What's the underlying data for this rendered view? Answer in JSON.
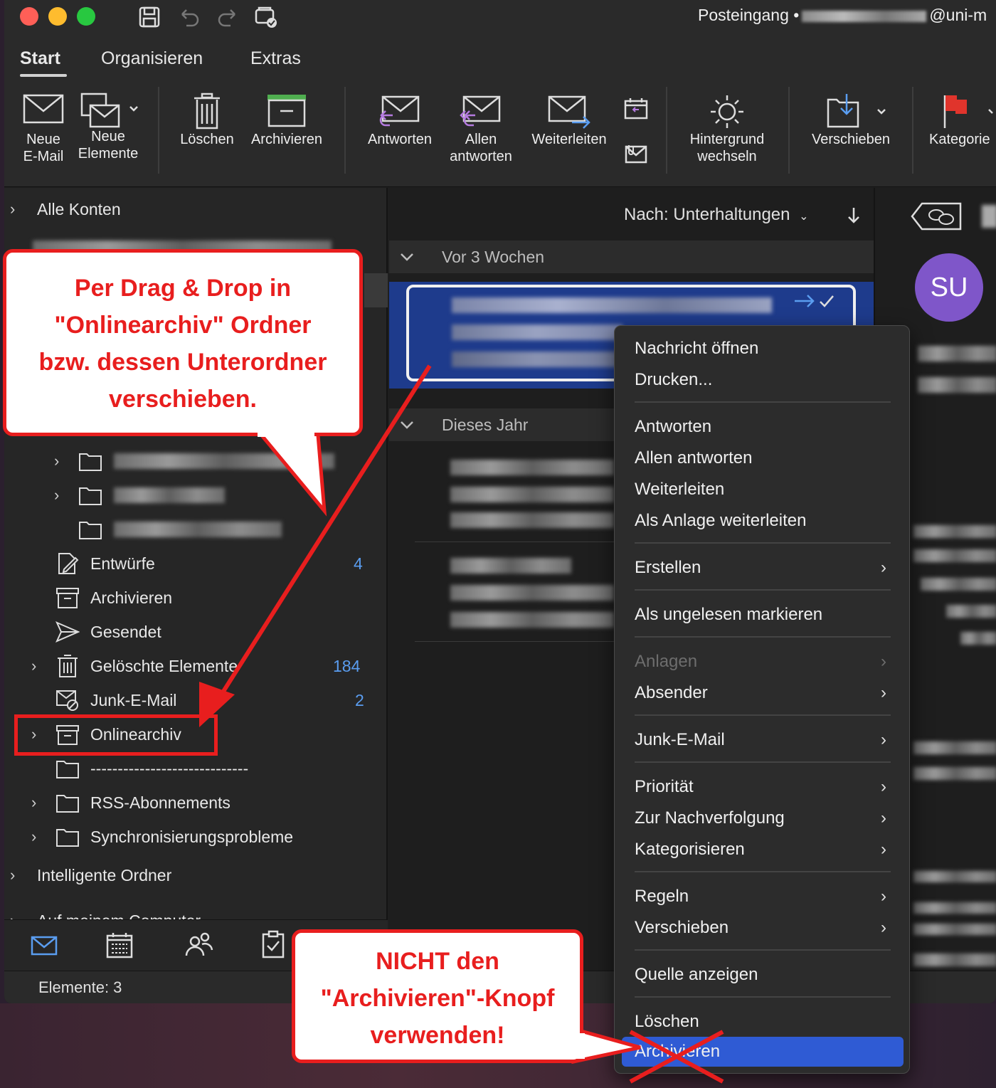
{
  "titlebar": {
    "title_prefix": "Posteingang •",
    "title_suffix": "@uni-m",
    "save_icon": "save-icon",
    "undo_icon": "undo-icon",
    "redo_icon": "redo-icon",
    "sync_icon": "sync-icon"
  },
  "ribbon": {
    "tabs": [
      "Start",
      "Organisieren",
      "Extras"
    ],
    "buttons": {
      "new_email": [
        "Neue",
        "E-Mail"
      ],
      "new_items": [
        "Neue",
        "Elemente"
      ],
      "delete": "Löschen",
      "archive": "Archivieren",
      "reply": "Antworten",
      "reply_all": [
        "Allen",
        "antworten"
      ],
      "forward": "Weiterleiten",
      "background": [
        "Hintergrund",
        "wechseln"
      ],
      "move": "Verschieben",
      "categorize": "Kategorie"
    }
  },
  "sidebar": {
    "all_accounts": "Alle Konten",
    "folders": {
      "drafts": "Entwürfe",
      "drafts_count": "4",
      "archive": "Archivieren",
      "sent": "Gesendet",
      "deleted": "Gelöschte Elemente",
      "deleted_count": "184",
      "junk": "Junk-E-Mail",
      "junk_count": "2",
      "online_archive": "Onlinearchiv",
      "separator": "-----------------------------",
      "rss": "RSS-Abonnements",
      "sync_problems": "Synchronisierungsprobleme"
    },
    "smart_folders": "Intelligente Ordner",
    "on_my_computer": "Auf meinem Computer"
  },
  "status": {
    "items": "Elemente: 3"
  },
  "message_list": {
    "sort_label": "Nach: Unterhaltungen",
    "groups": [
      "Vor 3 Wochen",
      "Dieses Jahr"
    ]
  },
  "reading_pane": {
    "avatar": "SU"
  },
  "context_menu": {
    "items": [
      {
        "label": "Nachricht öffnen"
      },
      {
        "label": "Drucken..."
      },
      {
        "label": "Antworten"
      },
      {
        "label": "Allen antworten"
      },
      {
        "label": "Weiterleiten"
      },
      {
        "label": "Als Anlage weiterleiten"
      },
      {
        "label": "Erstellen"
      },
      {
        "label": "Als ungelesen markieren"
      },
      {
        "label": "Anlagen"
      },
      {
        "label": "Absender"
      },
      {
        "label": "Junk-E-Mail"
      },
      {
        "label": "Priorität"
      },
      {
        "label": "Zur Nachverfolgung"
      },
      {
        "label": "Kategorisieren"
      },
      {
        "label": "Regeln"
      },
      {
        "label": "Verschieben"
      },
      {
        "label": "Quelle anzeigen"
      },
      {
        "label": "Löschen"
      },
      {
        "label": "Archivieren"
      }
    ]
  },
  "callouts": {
    "drag_drop": [
      "Per Drag & Drop in",
      "\"Onlinearchiv\" Ordner",
      "bzw. dessen Unterordner",
      "verschieben."
    ],
    "not_archive": [
      "NICHT den",
      "\"Archivieren\"-Knopf",
      "verwenden!"
    ]
  },
  "colors": {
    "accent_red": "#e81e1e",
    "count_blue": "#5a9df0",
    "selection_blue": "#2f5bd4",
    "avatar_purple": "#7f56c9"
  }
}
